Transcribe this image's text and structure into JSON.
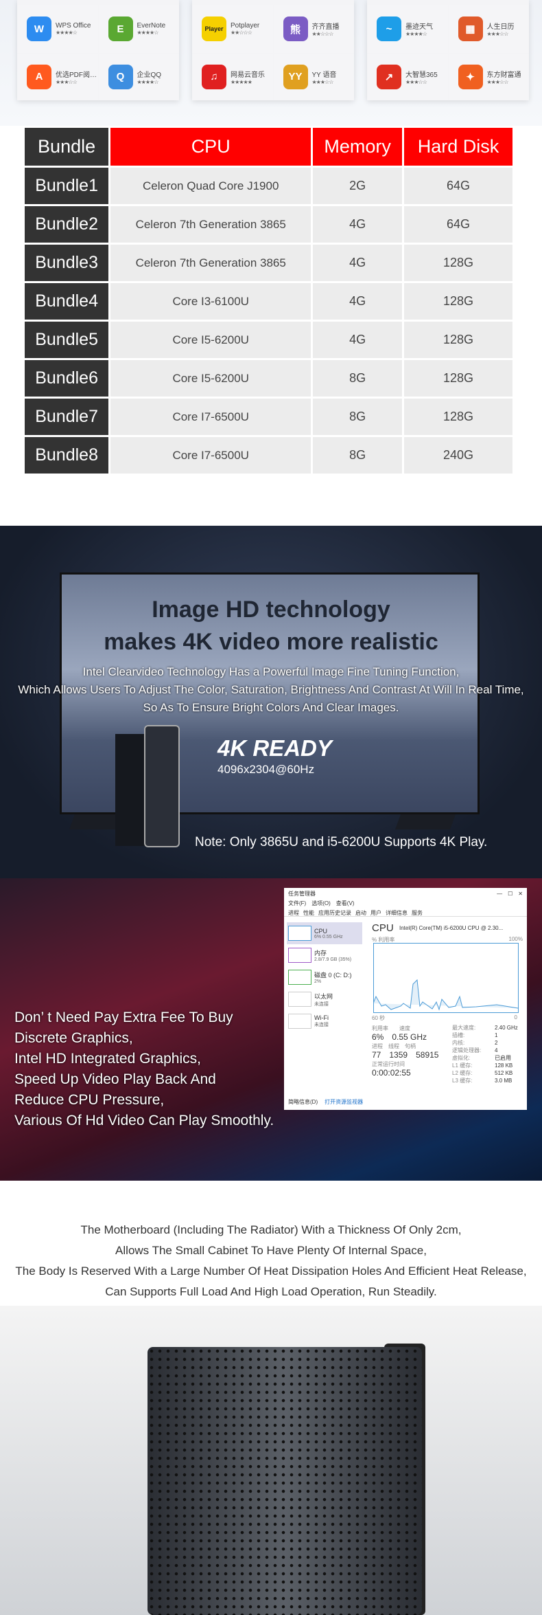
{
  "apps": {
    "panels": [
      [
        {
          "name": "WPS Office",
          "stars": "★★★★☆",
          "color": "#2d8cf0",
          "glyph": "W"
        },
        {
          "name": "EverNote",
          "stars": "★★★★☆",
          "color": "#5aa832",
          "glyph": "E"
        },
        {
          "name": "优选PDF阅…",
          "stars": "★★★☆☆",
          "color": "#ff5a1f",
          "glyph": "A"
        },
        {
          "name": "企业QQ",
          "stars": "★★★★☆",
          "color": "#3d8ee0",
          "glyph": "Q"
        }
      ],
      [
        {
          "name": "Potplayer",
          "stars": "★★☆☆☆",
          "color": "#f5d000",
          "glyph": "Player"
        },
        {
          "name": "齐齐直播",
          "stars": "★★☆☆☆",
          "color": "#7b5cc4",
          "glyph": "熊"
        },
        {
          "name": "网易云音乐",
          "stars": "★★★★★",
          "color": "#e02020",
          "glyph": "♫"
        },
        {
          "name": "YY 语音",
          "stars": "★★★☆☆",
          "color": "#e0a020",
          "glyph": "YY"
        }
      ],
      [
        {
          "name": "墨迹天气",
          "stars": "★★★★☆",
          "color": "#1e9ee8",
          "glyph": "~"
        },
        {
          "name": "人生日历",
          "stars": "★★★☆☆",
          "color": "#e05a2a",
          "glyph": "▦"
        },
        {
          "name": "大智慧365",
          "stars": "★★★☆☆",
          "color": "#e03020",
          "glyph": "↗"
        },
        {
          "name": "东方财富通",
          "stars": "★★★☆☆",
          "color": "#f06020",
          "glyph": "✦"
        }
      ]
    ]
  },
  "table": {
    "headers": [
      "Bundle",
      "CPU",
      "Memory",
      "Hard Disk"
    ],
    "rows": [
      [
        "Bundle1",
        "Celeron Quad Core J1900",
        "2G",
        "64G"
      ],
      [
        "Bundle2",
        "Celeron 7th Generation 3865",
        "4G",
        "64G"
      ],
      [
        "Bundle3",
        "Celeron 7th Generation 3865",
        "4G",
        "128G"
      ],
      [
        "Bundle4",
        "Core I3-6100U",
        "4G",
        "128G"
      ],
      [
        "Bundle5",
        "Core I5-6200U",
        "4G",
        "128G"
      ],
      [
        "Bundle6",
        "Core I5-6200U",
        "8G",
        "128G"
      ],
      [
        "Bundle7",
        "Core I7-6500U",
        "8G",
        "128G"
      ],
      [
        "Bundle8",
        "Core I7-6500U",
        "8G",
        "240G"
      ]
    ]
  },
  "hd": {
    "title1": "Image HD technology",
    "title2": "makes 4K video more realistic",
    "lines": [
      "Intel Clearvideo Technology Has a Powerful Image Fine Tuning Function,",
      "Which Allows Users To Adjust The Color, Saturation, Brightness And Contrast At Will In Real Time,",
      "So As To Ensure Bright Colors And Clear Images."
    ],
    "badge": "4K READY",
    "resolution": "4096x2304@60Hz",
    "note": "Note:  Only 3865U and i5-6200U Supports 4K Play."
  },
  "video": {
    "lines": [
      "Don’  t Need Pay Extra Fee To Buy",
      "Discrete Graphics,",
      "Intel HD Integrated Graphics,",
      "Speed Up Video Play Back And",
      "Reduce CPU Pressure,",
      "Various Of Hd Video Can Play Smoothly."
    ]
  },
  "taskmgr": {
    "title": "任务管理器",
    "menu": [
      "文件(F)",
      "选项(O)",
      "查看(V)"
    ],
    "tabs": [
      "进程",
      "性能",
      "应用历史记录",
      "启动",
      "用户",
      "详细信息",
      "服务"
    ],
    "side": [
      {
        "name": "CPU",
        "sub": "6% 0.55 GHz"
      },
      {
        "name": "内存",
        "sub": "2.8/7.9 GB (35%)"
      },
      {
        "name": "磁盘 0 (C: D:)",
        "sub": "2%"
      },
      {
        "name": "以太网",
        "sub": "未连接"
      },
      {
        "name": "Wi-Fi",
        "sub": "未连接"
      }
    ],
    "cpu_label": "CPU",
    "cpu_model": "Intel(R) Core(TM) i5-6200U CPU @ 2.30...",
    "util_label": "% 利用率",
    "max": "100%",
    "time_left": "60 秒",
    "time_right": "0",
    "stats": {
      "util_l": "利用率",
      "util": "6%",
      "speed_l": "速度",
      "speed": "0.55 GHz",
      "proc_l": "进程",
      "proc": "77",
      "thr_l": "线程",
      "thr": "1359",
      "hdl_l": "句柄",
      "hdl": "58915",
      "up_l": "正常运行时间",
      "up": "0:00:02:55"
    },
    "specs": [
      [
        "最大速度:",
        "2.40 GHz"
      ],
      [
        "插槽:",
        "1"
      ],
      [
        "内核:",
        "2"
      ],
      [
        "逻辑处理器:",
        "4"
      ],
      [
        "虚拟化:",
        "已启用"
      ],
      [
        "L1 缓存:",
        "128 KB"
      ],
      [
        "L2 缓存:",
        "512 KB"
      ],
      [
        "L3 缓存:",
        "3.0 MB"
      ]
    ],
    "footer_left": "简略信息(D)",
    "footer_right": "打开资源监视器"
  },
  "info": {
    "lines": [
      "The Motherboard (Including The Radiator) With a Thickness Of Only 2cm,",
      "Allows The Small Cabinet To Have Plenty Of Internal Space,",
      "The Body Is Reserved With a Large Number Of Heat Dissipation Holes And Efficient Heat Release,",
      "Can Supports Full Load And High Load Operation, Run Steadily."
    ]
  }
}
